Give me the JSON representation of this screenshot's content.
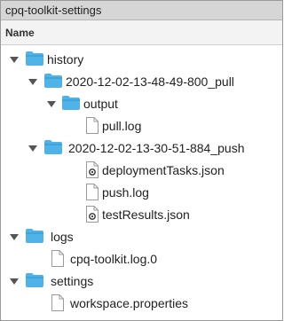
{
  "window": {
    "title": "cpq-toolkit-settings"
  },
  "column_header": {
    "name_label": "Name"
  },
  "colors": {
    "folder_blue": "#4fb3e8",
    "folder_blue_dark": "#2f95cf",
    "title_bar": "#d6d6d6",
    "chevron": "#555555"
  },
  "tree": {
    "history": {
      "label": "history",
      "expanded": true,
      "pull_folder": {
        "label": "2020-12-02-13-48-49-800_pull",
        "expanded": true,
        "output": {
          "label": "output",
          "expanded": true,
          "files": [
            {
              "label": "pull.log",
              "icon": "document-icon"
            }
          ]
        }
      },
      "push_folder": {
        "label": "2020-12-02-13-30-51-884_push",
        "expanded": true,
        "files": [
          {
            "label": "deploymentTasks.json",
            "icon": "json-file-icon"
          },
          {
            "label": "push.log",
            "icon": "document-icon"
          },
          {
            "label": "testResults.json",
            "icon": "json-file-icon"
          }
        ]
      }
    },
    "logs": {
      "label": "logs",
      "expanded": true,
      "files": [
        {
          "label": "cpq-toolkit.log.0",
          "icon": "document-icon"
        }
      ]
    },
    "settings": {
      "label": "settings",
      "expanded": true,
      "files": [
        {
          "label": "workspace.properties",
          "icon": "document-icon"
        }
      ]
    }
  }
}
